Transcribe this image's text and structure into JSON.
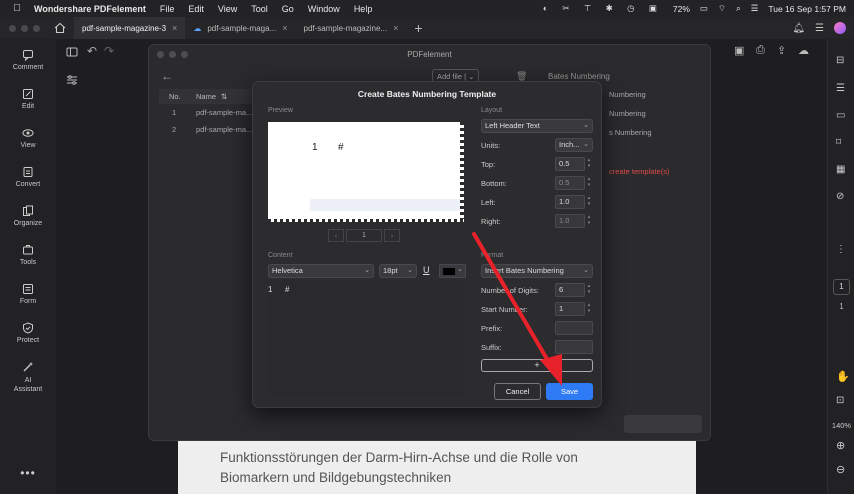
{
  "menubar": {
    "app_name": "Wondershare PDFelement",
    "items": [
      "File",
      "Edit",
      "View",
      "Tool",
      "Go",
      "Window",
      "Help"
    ],
    "battery": "72%",
    "datetime": "Tue 16 Sep  1:57 PM"
  },
  "tabs": [
    {
      "label": "pdf-sample-magazine-3",
      "active": true,
      "cloud": false
    },
    {
      "label": "pdf-sample-maga...",
      "active": false,
      "cloud": true
    },
    {
      "label": "pdf-sample-magazine...",
      "active": false,
      "cloud": false
    }
  ],
  "left_sidebar": [
    {
      "label": "Comment",
      "icon": "comment-icon"
    },
    {
      "label": "Edit",
      "icon": "edit-icon"
    },
    {
      "label": "View",
      "icon": "eye-icon"
    },
    {
      "label": "Convert",
      "icon": "convert-icon"
    },
    {
      "label": "Organize",
      "icon": "organize-icon"
    },
    {
      "label": "Tools",
      "icon": "tools-icon"
    },
    {
      "label": "Form",
      "icon": "form-icon"
    },
    {
      "label": "Protect",
      "icon": "shield-icon"
    },
    {
      "label": "AI\nAssistant",
      "icon": "ai-icon"
    }
  ],
  "right_sidebar": {
    "page_current": "1",
    "page_total": "1",
    "zoom": "140%"
  },
  "document": {
    "line1": "Funktionsstörungen der Darm-Hirn-Achse und die Rolle von",
    "line2": "Biomarkern und Bildgebungstechniken"
  },
  "pdf_window": {
    "title": "PDFelement",
    "add_file": "Add file",
    "list_header": {
      "no": "No.",
      "name": "Name"
    },
    "rows": [
      {
        "no": "1",
        "name": "pdf-sample-ma..."
      },
      {
        "no": "2",
        "name": "pdf-sample-ma..."
      }
    ],
    "right_panel_title": "Bates Numbering",
    "right_items": [
      "Numbering",
      "Numbering",
      "s Numbering"
    ],
    "right_warning": "create template(s)"
  },
  "dialog": {
    "title": "Create Bates Numbering Template",
    "preview_label": "Preview",
    "preview_number": "1",
    "preview_hash": "#",
    "page_value": "1",
    "content_label": "Content",
    "font": "Helvetica",
    "font_size": "18pt",
    "underline": "U",
    "content_number": "1",
    "content_hash": "#",
    "layout_label": "Layout",
    "position": "Left Header Text",
    "units_label": "Units:",
    "units_value": "Inch...",
    "top_label": "Top:",
    "top_value": "0.5",
    "bottom_label": "Bottom:",
    "bottom_value": "0.5",
    "left_label": "Left:",
    "left_value": "1.0",
    "right_label": "Right:",
    "right_value": "1.0",
    "format_label": "Format",
    "format_select": "Insert Bates Numbering",
    "digits_label": "Number of Digits:",
    "digits_value": "6",
    "start_label": "Start Number:",
    "start_value": "1",
    "prefix_label": "Prefix:",
    "suffix_label": "Suffix:",
    "add_label": "+",
    "cancel_label": "Cancel",
    "save_label": "Save"
  },
  "annotation": {
    "arrow_color": "#e8222a"
  }
}
